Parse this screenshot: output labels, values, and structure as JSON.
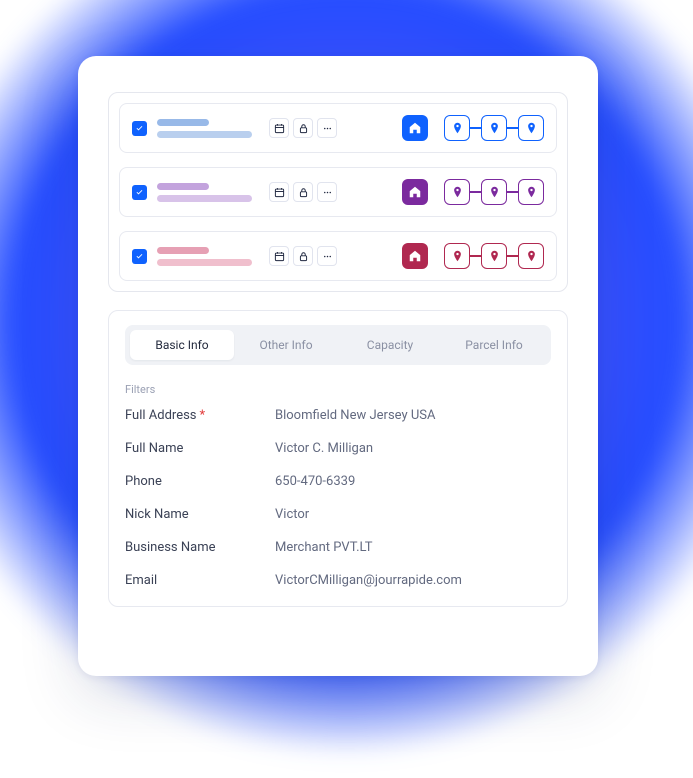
{
  "colors": {
    "blue": "#0f62fe",
    "purple": "#7b2a9e",
    "pink": "#b02850"
  },
  "rows": [
    {
      "theme": "blue"
    },
    {
      "theme": "purple"
    },
    {
      "theme": "pink"
    }
  ],
  "tabs": {
    "basic": "Basic Info",
    "other": "Other Info",
    "capacity": "Capacity",
    "parcel": "Parcel Info"
  },
  "filters_label": "Filters",
  "fields": {
    "full_address": {
      "label": "Full Address",
      "required": true,
      "value": "Bloomfield New Jersey USA"
    },
    "full_name": {
      "label": "Full Name",
      "value": "Victor C. Milligan"
    },
    "phone": {
      "label": "Phone",
      "value": "650-470-6339"
    },
    "nick_name": {
      "label": "Nick Name",
      "value": "Victor"
    },
    "business_name": {
      "label": "Business Name",
      "value": "Merchant PVT.LT"
    },
    "email": {
      "label": "Email",
      "value": "VictorCMilligan@jourrapide.com"
    }
  }
}
